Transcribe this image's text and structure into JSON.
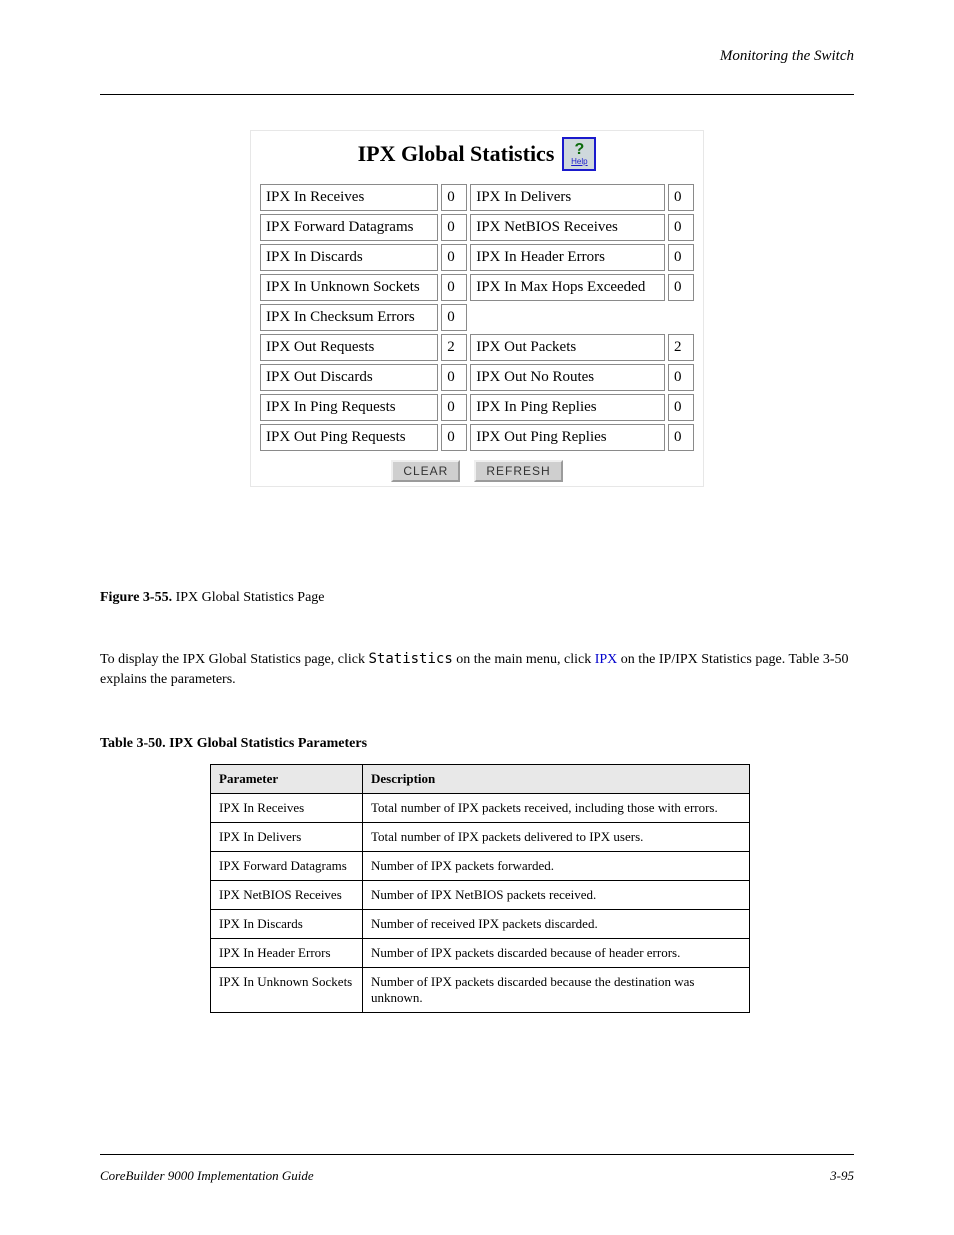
{
  "header": {
    "section": "Monitoring the Switch"
  },
  "figure": {
    "title": "IPX Global Statistics",
    "help_label": "Help",
    "stats": [
      {
        "l_label": "IPX In Receives",
        "l_val": "0",
        "r_label": "IPX In Delivers",
        "r_val": "0"
      },
      {
        "l_label": "IPX Forward Datagrams",
        "l_val": "0",
        "r_label": "IPX NetBIOS Receives",
        "r_val": "0"
      },
      {
        "l_label": "IPX In Discards",
        "l_val": "0",
        "r_label": "IPX In Header Errors",
        "r_val": "0"
      },
      {
        "l_label": "IPX In Unknown Sockets",
        "l_val": "0",
        "r_label": "IPX In Max Hops Exceeded",
        "r_val": "0"
      },
      {
        "l_label": "IPX In Checksum Errors",
        "l_val": "0",
        "r_label": "",
        "r_val": ""
      },
      {
        "l_label": "IPX Out Requests",
        "l_val": "2",
        "r_label": "IPX Out Packets",
        "r_val": "2"
      },
      {
        "l_label": "IPX Out Discards",
        "l_val": "0",
        "r_label": "IPX Out No Routes",
        "r_val": "0"
      },
      {
        "l_label": "IPX In Ping Requests",
        "l_val": "0",
        "r_label": "IPX In Ping Replies",
        "r_val": "0"
      },
      {
        "l_label": "IPX Out Ping Requests",
        "l_val": "0",
        "r_label": "IPX Out Ping Replies",
        "r_val": "0"
      }
    ],
    "buttons": {
      "clear": "CLEAR",
      "refresh": "REFRESH"
    }
  },
  "caption": {
    "num": "Figure 3-55.",
    "text": "  IPX Global Statistics Page"
  },
  "intro": {
    "text_a": "To display the IPX Global Statistics page, click ",
    "mono": "Statistics",
    "text_b": " on the main menu, click ",
    "link": "IPX",
    "text_c": " on the IP/IPX Statistics page. Table 3-50 explains the parameters."
  },
  "table": {
    "title": "Table 3-50. IPX Global Statistics Parameters",
    "head": {
      "param": "Parameter",
      "desc": "Description"
    },
    "rows": [
      {
        "param": "IPX In Receives",
        "desc": "Total number of IPX packets received, including those with errors."
      },
      {
        "param": "IPX In Delivers",
        "desc": "Total number of IPX packets delivered to IPX users."
      },
      {
        "param": "IPX Forward Datagrams",
        "desc": "Number of IPX packets forwarded."
      },
      {
        "param": "IPX NetBIOS Receives",
        "desc": "Number of IPX NetBIOS packets received."
      },
      {
        "param": "IPX In Discards",
        "desc": "Number of received IPX packets discarded."
      },
      {
        "param": "IPX In Header Errors",
        "desc": "Number of IPX packets discarded because of header errors."
      },
      {
        "param": "IPX In Unknown Sockets",
        "desc": "Number of IPX packets discarded because the destination was unknown."
      }
    ]
  },
  "footer": {
    "left": "CoreBuilder 9000 Implementation Guide",
    "right": "3-95"
  }
}
